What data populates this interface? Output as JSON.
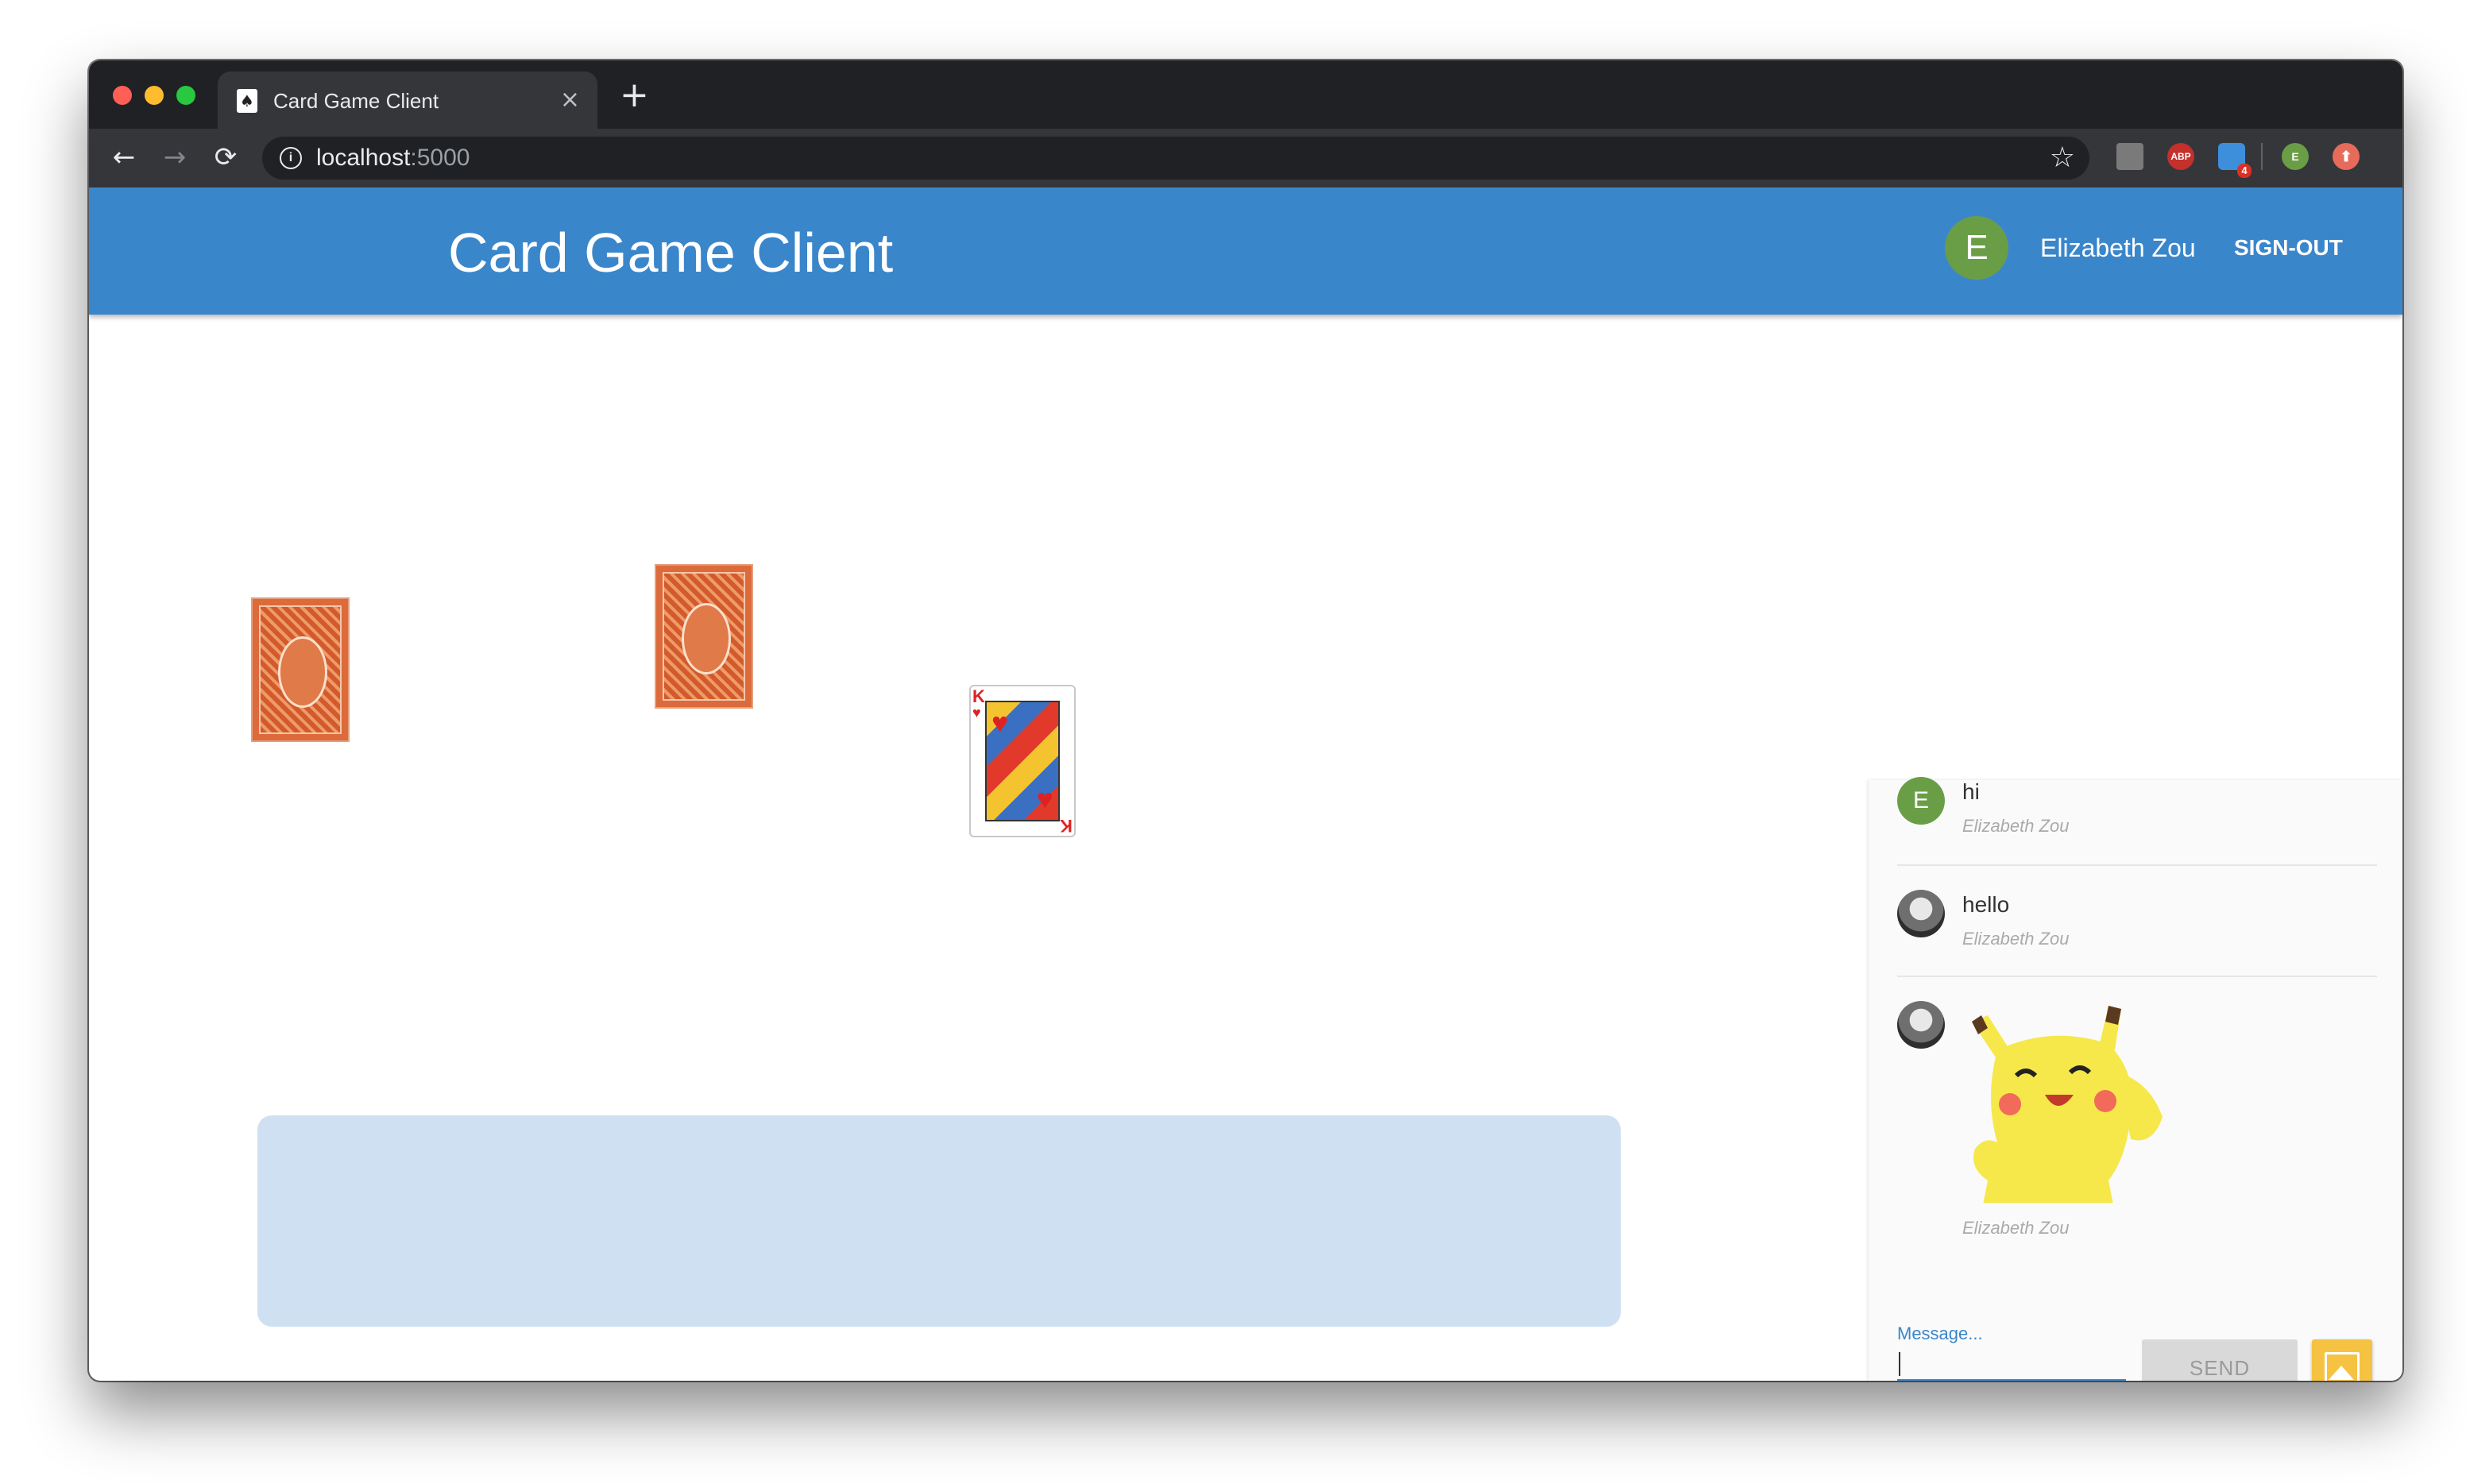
{
  "browser": {
    "tab_title": "Card Game Client",
    "tab_close": "×",
    "new_tab": "+",
    "url_host": "localhost",
    "url_port": ":5000",
    "nav": {
      "back": "←",
      "forward": "→",
      "reload": "⟳"
    },
    "star": "☆",
    "extensions": [
      {
        "name": "extension-icon",
        "label": ""
      },
      {
        "name": "adblock-plus-icon",
        "label": "ABP"
      },
      {
        "name": "tasks-extension-icon",
        "label": "4"
      },
      {
        "name": "profile-avatar-icon",
        "label": "E"
      },
      {
        "name": "update-icon",
        "label": "⬆"
      }
    ]
  },
  "app": {
    "title": "Card Game Client",
    "avatar_letter": "E",
    "user_name": "Elizabeth Zou",
    "signout_label": "SIGN-OUT",
    "brand_color": "#3a86cb"
  },
  "table": {
    "cards": [
      {
        "name": "card-back-1",
        "face": "back"
      },
      {
        "name": "card-back-2",
        "face": "back"
      },
      {
        "name": "king-of-hearts-card",
        "face": "K",
        "suit": "♥"
      }
    ]
  },
  "chat": {
    "messages": [
      {
        "avatar": "E",
        "text": "hi",
        "author": "Elizabeth Zou"
      },
      {
        "avatar": "horse-photo",
        "text": "hello",
        "author": "Elizabeth Zou"
      },
      {
        "avatar": "horse-photo",
        "image": "pikachu",
        "author": "Elizabeth Zou"
      }
    ],
    "input_label": "Message...",
    "input_value": "",
    "send_label": "SEND"
  }
}
